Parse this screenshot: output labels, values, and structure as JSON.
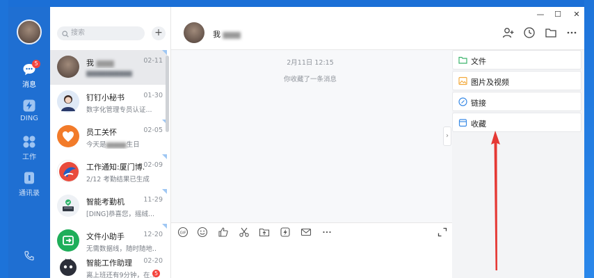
{
  "nav": {
    "items": [
      {
        "label": "消息",
        "badge": "5",
        "icon": "chat-bubble-icon"
      },
      {
        "label": "DING",
        "icon": "ding-lightning-icon"
      },
      {
        "label": "工作",
        "icon": "apps-grid-icon"
      },
      {
        "label": "通讯录",
        "icon": "contacts-book-icon"
      }
    ]
  },
  "search": {
    "placeholder": "搜索"
  },
  "conversations": [
    {
      "name": "我",
      "preview": "",
      "time": "02-11"
    },
    {
      "name": "钉钉小秘书",
      "preview": "数字化管理专员认证...",
      "time": "01-30"
    },
    {
      "name": "员工关怀",
      "preview": "今天是",
      "preview_tail": "生日",
      "time": "02-05"
    },
    {
      "name": "工作通知:厦门博...",
      "preview": "2/12 考勤结果已生成",
      "time": "02-09"
    },
    {
      "name": "智能考勤机",
      "preview": "[DING]恭喜您，摇绒...",
      "time": "11-29"
    },
    {
      "name": "文件小助手",
      "preview": "无需数据线，随时随地...",
      "time": "12-20"
    },
    {
      "name": "智能工作助理",
      "preview": "离上班还有9分钟，在...",
      "time": "02-20",
      "unread": "5"
    }
  ],
  "chat": {
    "title": "我",
    "date_stamp": "2月11日 12:15",
    "system_note": "你收藏了一条消息"
  },
  "window": {
    "minimize": "—",
    "maximize": "☐",
    "close": "✕"
  },
  "side_panel": {
    "items": [
      {
        "label": "文件",
        "icon": "folder-icon",
        "color": "#3bb36b"
      },
      {
        "label": "图片及视频",
        "icon": "image-icon",
        "color": "#f2a93b"
      },
      {
        "label": "链接",
        "icon": "link-icon",
        "color": "#3a8be6"
      },
      {
        "label": "收藏",
        "icon": "favorites-box-icon",
        "color": "#3a8be6"
      }
    ]
  },
  "colors": {
    "brand": "#1f6fd2",
    "annotation": "#e53935",
    "badge": "#f4433c"
  }
}
